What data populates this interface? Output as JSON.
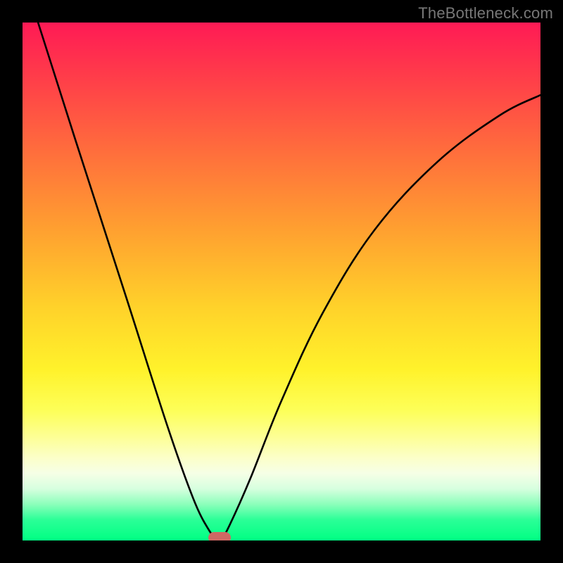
{
  "watermark": "TheBottleneck.com",
  "chart_data": {
    "type": "line",
    "title": "",
    "xlabel": "",
    "ylabel": "",
    "xlim": [
      0,
      100
    ],
    "ylim": [
      0,
      100
    ],
    "grid": false,
    "legend": false,
    "series": [
      {
        "name": "bottleneck-curve",
        "x": [
          3,
          10,
          20,
          28,
          33,
          36,
          37.5,
          38.5,
          40,
          44,
          50,
          58,
          68,
          80,
          92,
          100
        ],
        "y": [
          100,
          78,
          47,
          22,
          8,
          2,
          0.5,
          0.5,
          3,
          12,
          27,
          44,
          60,
          73,
          82,
          86
        ]
      }
    ],
    "markers": [
      {
        "name": "optimal-point",
        "x": 38,
        "y": 0.5,
        "color": "#cf6964"
      }
    ],
    "background_gradient": {
      "top": "#ff1a55",
      "mid": "#fff22b",
      "bottom": "#00ff83"
    }
  }
}
